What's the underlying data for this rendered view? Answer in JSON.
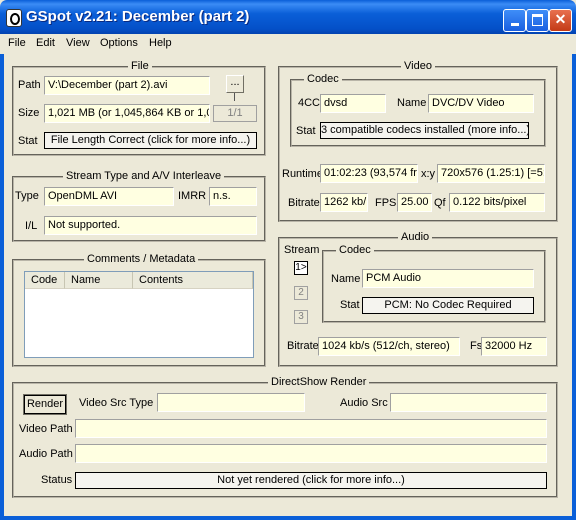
{
  "window": {
    "title": "GSpot v2.21: December (part 2)"
  },
  "menu": [
    "File",
    "Edit",
    "View",
    "Options",
    "Help"
  ],
  "file": {
    "group_title": "File",
    "path_label": "Path",
    "path_value": "V:\\December (part 2).avi",
    "browse_label": "...",
    "size_label": "Size",
    "size_value": "1,021 MB (or 1,045,864 KB or 1,0",
    "part_counter": "1/1",
    "stat_label": "Stat",
    "stat_value": "File Length Correct (click for more info...)"
  },
  "interleave": {
    "group_title": "Stream Type and A/V Interleave",
    "type_label": "Type",
    "type_value": "OpenDML AVI",
    "imrr_label": "IMRR",
    "imrr_value": "n.s.",
    "il_label": "I/L",
    "il_value": "Not supported."
  },
  "comments": {
    "group_title": "Comments / Metadata",
    "columns": [
      "Code",
      "Name",
      "Contents"
    ]
  },
  "video": {
    "group_title": "Video",
    "codec_title": "Codec",
    "fourcc_label": "4CC",
    "fourcc_value": "dvsd",
    "name_label": "Name",
    "name_value": "DVC/DV Video",
    "stat_label": "Stat",
    "stat_value": "3 compatible codecs installed (more info...)",
    "runtime_label": "Runtime",
    "runtime_value": "01:02:23 (93,574 fr",
    "xy_label": "x:y",
    "xy_value": "720x576 (1.25:1) [=5:",
    "bitrate_label": "Bitrate",
    "bitrate_value": "1262 kb/",
    "fps_label": "FPS",
    "fps_value": "25.00",
    "qf_label": "Qf",
    "qf_value": "0.122 bits/pixel"
  },
  "audio": {
    "group_title": "Audio",
    "stream_label": "Stream",
    "streams": [
      "1>",
      "2",
      "3"
    ],
    "codec_title": "Codec",
    "name_label": "Name",
    "name_value": "PCM Audio",
    "stat_label": "Stat",
    "stat_value": "PCM: No Codec Required",
    "bitrate_label": "Bitrate",
    "bitrate_value": "1024 kb/s (512/ch, stereo)",
    "fs_label": "Fs",
    "fs_value": "32000 Hz"
  },
  "directshow": {
    "group_title": "DirectShow Render",
    "render_button": "Render",
    "video_src_type_label": "Video Src Type",
    "video_src_type_value": "",
    "audio_src_label": "Audio Src",
    "audio_src_value": "",
    "video_path_label": "Video Path",
    "video_path_value": "",
    "audio_path_label": "Audio Path",
    "audio_path_value": "",
    "status_label": "Status",
    "status_value": "Not yet rendered (click for more info...)"
  }
}
